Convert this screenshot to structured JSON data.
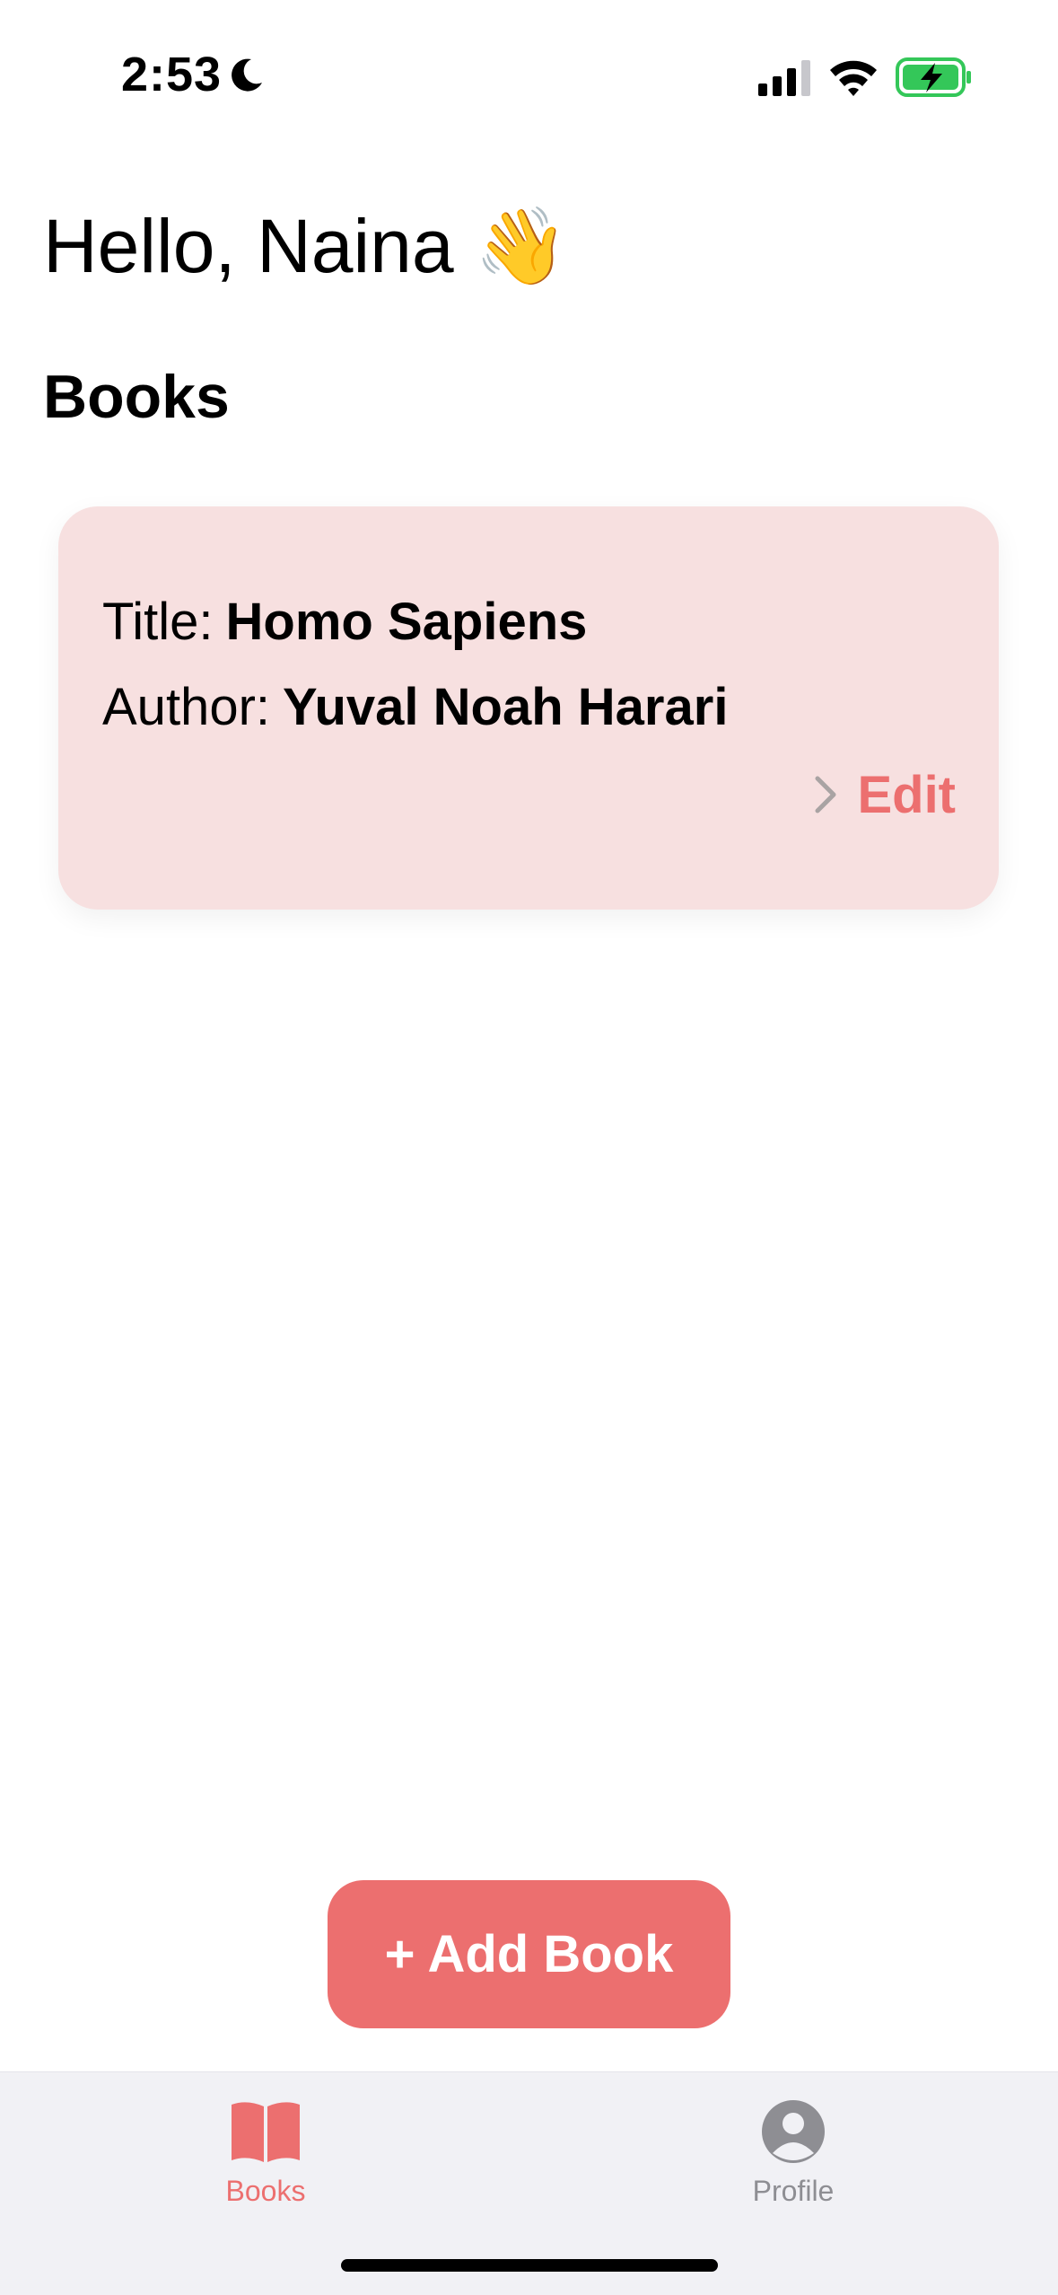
{
  "status_bar": {
    "time": "2:53",
    "icons": [
      "moon-icon",
      "signal-icon",
      "wifi-icon",
      "battery-charging-icon"
    ],
    "battery_color": "#34c759"
  },
  "greeting": {
    "text": "Hello, Naina 👋"
  },
  "section": {
    "title": "Books"
  },
  "book": {
    "title_label": "Title:",
    "title_value": "Homo Sapiens",
    "author_label": "Author:",
    "author_value": "Yuval Noah Harari",
    "edit_label": "Edit"
  },
  "add_button": {
    "label": "+ Add Book"
  },
  "tab_bar": {
    "tabs": [
      {
        "label": "Books",
        "icon": "book-icon",
        "selected": true
      },
      {
        "label": "Profile",
        "icon": "person-circle-icon",
        "selected": false
      }
    ]
  },
  "colors": {
    "accent": "#ec6f6f",
    "card_background": "#f7e0e0",
    "tab_bar_background": "#f1f1f5",
    "inactive_tab": "#8e8e93"
  }
}
